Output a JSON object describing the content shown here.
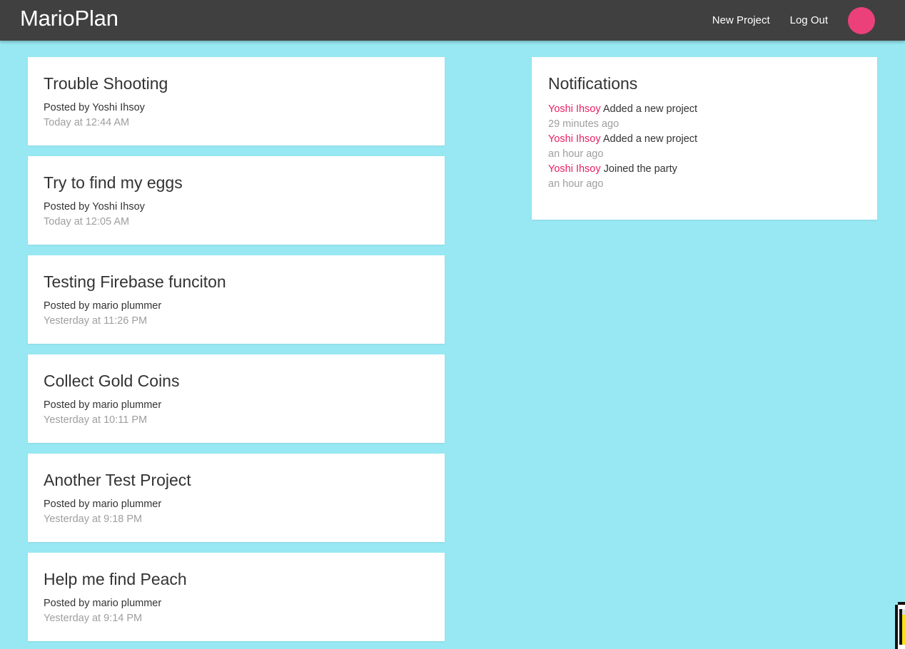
{
  "navbar": {
    "brand": "MarioPlan",
    "links": [
      {
        "label": "New Project"
      },
      {
        "label": "Log Out"
      }
    ],
    "avatar_color": "#ec407a"
  },
  "projects": [
    {
      "title": "Trouble Shooting",
      "author": "Posted by Yoshi Ihsoy",
      "date": "Today at 12:44 AM"
    },
    {
      "title": "Try to find my eggs",
      "author": "Posted by Yoshi Ihsoy",
      "date": "Today at 12:05 AM"
    },
    {
      "title": "Testing Firebase funciton",
      "author": "Posted by mario plummer",
      "date": "Yesterday at 11:26 PM"
    },
    {
      "title": "Collect Gold Coins",
      "author": "Posted by mario plummer",
      "date": "Yesterday at 10:11 PM"
    },
    {
      "title": "Another Test Project",
      "author": "Posted by mario plummer",
      "date": "Yesterday at 9:18 PM"
    },
    {
      "title": "Help me find Peach",
      "author": "Posted by mario plummer",
      "date": "Yesterday at 9:14 PM"
    }
  ],
  "notifications": {
    "title": "Notifications",
    "items": [
      {
        "user": "Yoshi Ihsoy",
        "content": "Added a new project",
        "time": "29 minutes ago"
      },
      {
        "user": "Yoshi Ihsoy",
        "content": "Added a new project",
        "time": "an hour ago"
      },
      {
        "user": "Yoshi Ihsoy",
        "content": "Joined the party",
        "time": "an hour ago"
      }
    ]
  },
  "colors": {
    "background": "#97e8f2",
    "navbar": "#404040",
    "accent": "#e91e63",
    "muted": "#9e9e9e"
  }
}
